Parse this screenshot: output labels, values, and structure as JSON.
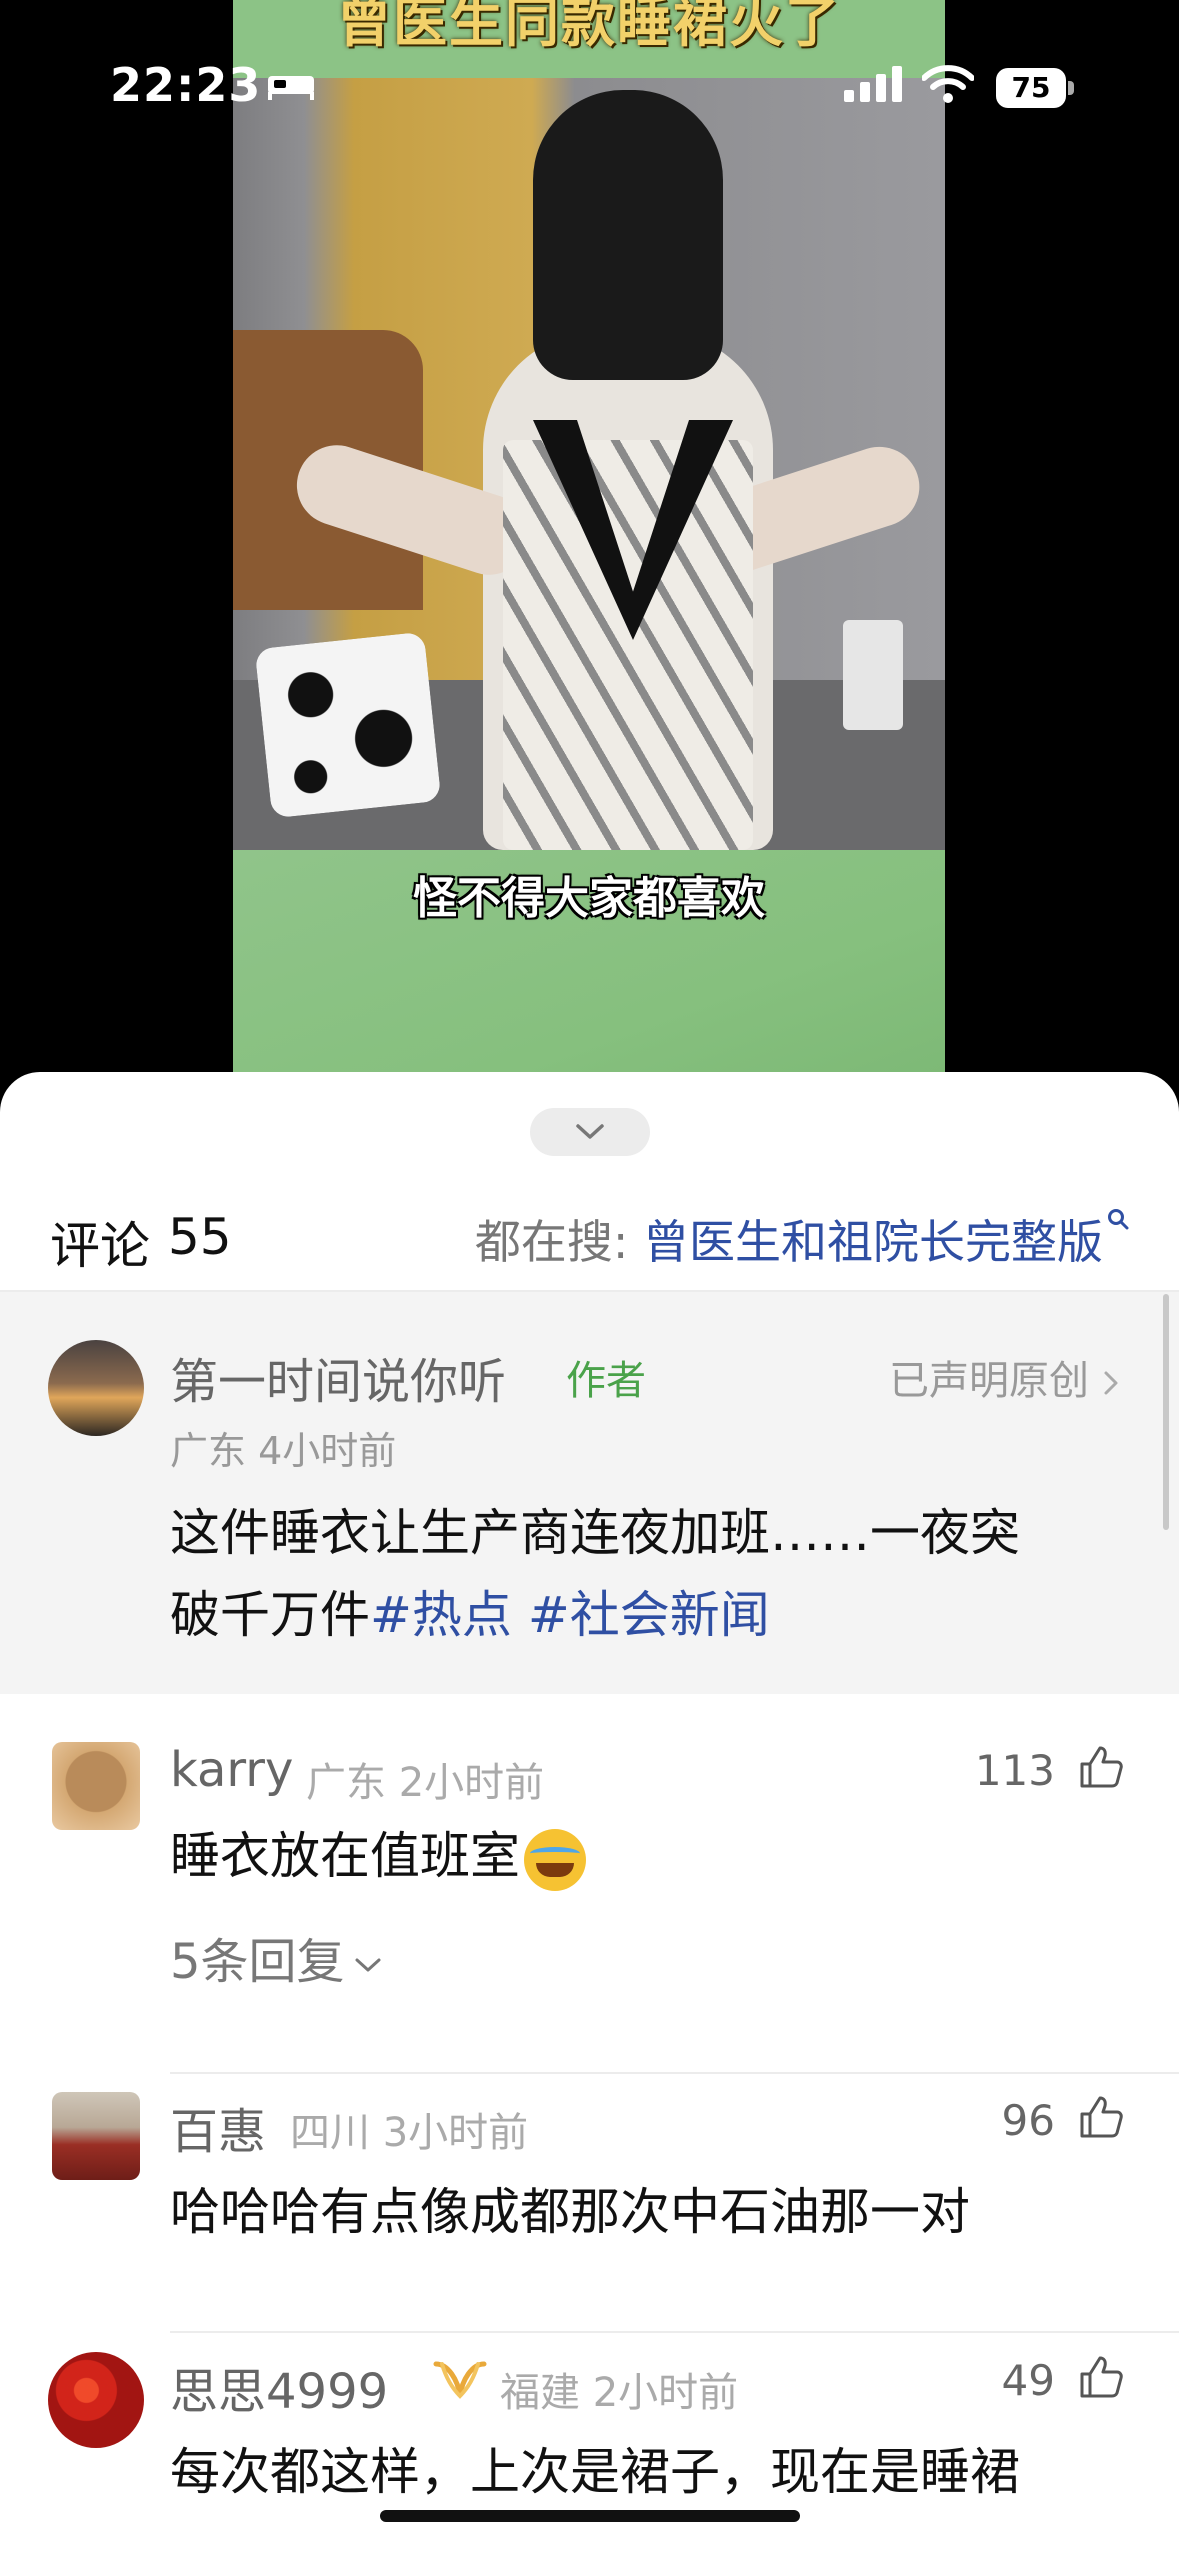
{
  "status_bar": {
    "time": "22:23",
    "battery": "75"
  },
  "video": {
    "title_overlay": "曾医生同款睡裙火了",
    "subtitle": "怪不得大家都喜欢"
  },
  "comments_header": {
    "title": "评论",
    "count": "55",
    "search_prefix": "都在搜:",
    "search_query": "曾医生和祖院长完整版"
  },
  "author_post": {
    "name": "第一时间说你听",
    "author_tag": "作者",
    "original_claim": "已声明原创",
    "location": "广东",
    "time": "4小时前",
    "text_line1": "这件睡衣让生产商连夜加班……一夜突",
    "text_line2_plain": "破千万件",
    "hashtag1": "#热点",
    "hashtag2": "#社会新闻"
  },
  "comments": [
    {
      "name": "karry",
      "location": "广东",
      "time": "2小时前",
      "likes": "113",
      "text": "睡衣放在值班室",
      "emoji": "crying-laughing-emoji",
      "replies": "5条回复"
    },
    {
      "name": "百惠",
      "location": "四川",
      "time": "3小时前",
      "likes": "96",
      "text": "哈哈哈有点像成都那次中石油那一对"
    },
    {
      "name": "思思4999",
      "badge": "vip-badge-icon",
      "location": "福建",
      "time": "2小时前",
      "likes": "49",
      "text": "每次都这样，上次是裙子，现在是睡裙"
    }
  ],
  "colors": {
    "link_blue": "#2f4fa3",
    "author_green": "#4aa24a",
    "video_green": "#86c07e"
  }
}
